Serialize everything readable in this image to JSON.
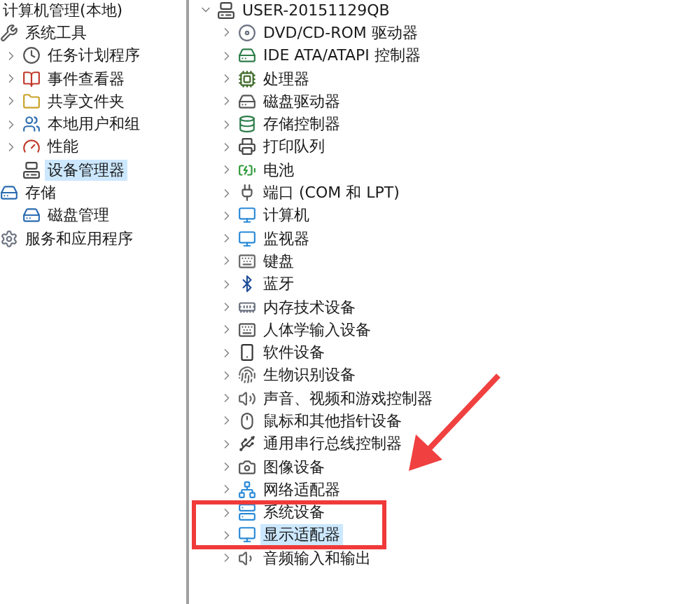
{
  "console_tree": {
    "label": "计算机管理(本地)",
    "children": [
      {
        "label": "系统工具",
        "selected": false,
        "children": [
          {
            "label": "任务计划程序",
            "expanded": false,
            "selected": false
          },
          {
            "label": "事件查看器",
            "expanded": false,
            "selected": false
          },
          {
            "label": "共享文件夹",
            "expanded": false,
            "selected": false
          },
          {
            "label": "本地用户和组",
            "expanded": false,
            "selected": false
          },
          {
            "label": "性能",
            "expanded": false,
            "selected": false
          },
          {
            "label": "设备管理器",
            "selected": true
          }
        ]
      },
      {
        "label": "存储",
        "selected": false,
        "children": [
          {
            "label": "磁盘管理",
            "selected": false
          }
        ]
      },
      {
        "label": "服务和应用程序",
        "selected": false
      }
    ]
  },
  "device_tree": {
    "label": "USER-20151129QB",
    "expanded": true,
    "children": [
      {
        "label": "DVD/CD-ROM 驱动器",
        "expanded": false,
        "selected": false
      },
      {
        "label": "IDE ATA/ATAPI 控制器",
        "expanded": false,
        "selected": false
      },
      {
        "label": "处理器",
        "expanded": false,
        "selected": false
      },
      {
        "label": "磁盘驱动器",
        "expanded": false,
        "selected": false
      },
      {
        "label": "存储控制器",
        "expanded": false,
        "selected": false
      },
      {
        "label": "打印队列",
        "expanded": false,
        "selected": false
      },
      {
        "label": "电池",
        "expanded": false,
        "selected": false
      },
      {
        "label": "端口 (COM 和 LPT)",
        "expanded": false,
        "selected": false
      },
      {
        "label": "计算机",
        "expanded": false,
        "selected": false
      },
      {
        "label": "监视器",
        "expanded": false,
        "selected": false
      },
      {
        "label": "键盘",
        "expanded": false,
        "selected": false
      },
      {
        "label": "蓝牙",
        "expanded": false,
        "selected": false
      },
      {
        "label": "内存技术设备",
        "expanded": false,
        "selected": false
      },
      {
        "label": "人体学输入设备",
        "expanded": false,
        "selected": false
      },
      {
        "label": "软件设备",
        "expanded": false,
        "selected": false
      },
      {
        "label": "生物识别设备",
        "expanded": false,
        "selected": false
      },
      {
        "label": "声音、视频和游戏控制器",
        "expanded": false,
        "selected": false
      },
      {
        "label": "鼠标和其他指针设备",
        "expanded": false,
        "selected": false
      },
      {
        "label": "通用串行总线控制器",
        "expanded": false,
        "selected": false
      },
      {
        "label": "图像设备",
        "expanded": false,
        "selected": false
      },
      {
        "label": "网络适配器",
        "expanded": false,
        "selected": false
      },
      {
        "label": "系统设备",
        "expanded": false,
        "selected": false
      },
      {
        "label": "显示适配器",
        "expanded": false,
        "selected": true
      },
      {
        "label": "音频输入和输出",
        "expanded": false,
        "selected": false
      }
    ]
  }
}
